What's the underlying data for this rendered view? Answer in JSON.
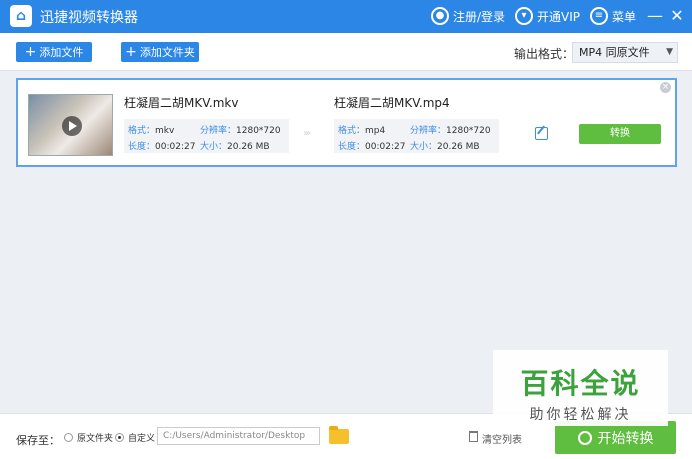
{
  "app": {
    "title": "迅捷视频转换器"
  },
  "titlebar": {
    "register_login": "注册/登录",
    "vip": "开通VIP",
    "menu": "菜单",
    "minimize": "—",
    "close": "✕"
  },
  "toolbar": {
    "add_file": "添加文件",
    "add_folder": "添加文件夹",
    "output_format_label": "输出格式：",
    "output_format_value": "MP4  同原文件"
  },
  "file": {
    "source": {
      "name": "枉凝眉二胡MKV.mkv",
      "format_key": "格式：",
      "format_val": "mkv",
      "res_key": "分辨率：",
      "res_val": "1280*720",
      "duration_key": "长度：",
      "duration_val": "00:02:27",
      "size_key": "大小：",
      "size_val": "20.26 MB"
    },
    "target": {
      "name": "枉凝眉二胡MKV.mp4",
      "format_key": "格式：",
      "format_val": "mp4",
      "res_key": "分辨率：",
      "res_val": "1280*720",
      "duration_key": "长度：",
      "duration_val": "00:02:27",
      "size_key": "大小：",
      "size_val": "20.26 MB"
    },
    "arrows": "›››",
    "convert_label": "转换"
  },
  "bottom": {
    "save_to_label": "保存至：",
    "option_original": "原文件夹",
    "option_custom": "自定义",
    "path": "C:/Users/Administrator/Desktop",
    "clear_list": "清空列表",
    "start_convert": "开始转换"
  },
  "watermark": {
    "main": "百科全说",
    "sub": "助你轻松解决"
  },
  "colors": {
    "primary": "#2b86e6",
    "success": "#5fbe3f"
  }
}
